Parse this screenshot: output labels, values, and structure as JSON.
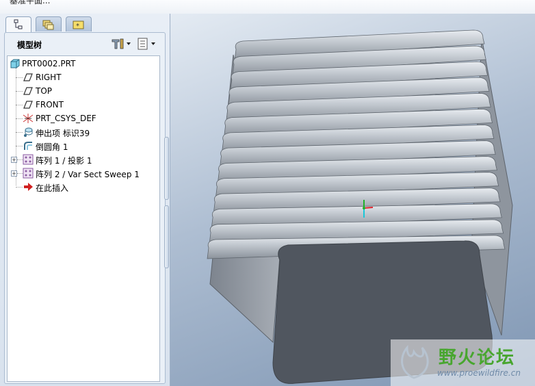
{
  "message_bar": {
    "text": "基准平面..."
  },
  "navigator": {
    "tabs": [
      {
        "name": "model-tree-tab",
        "icon": "model-tree-icon"
      },
      {
        "name": "folder-browser-tab",
        "icon": "folder-icon"
      },
      {
        "name": "favorites-tab",
        "icon": "favorites-icon"
      }
    ],
    "tree_title": "模型树",
    "tools": [
      {
        "name": "settings-button",
        "icon": "hammer-wrench-icon"
      },
      {
        "name": "show-button",
        "icon": "list-icon"
      }
    ],
    "items": [
      {
        "label": "PRT0002.PRT",
        "icon": "part-icon",
        "expandable": false
      },
      {
        "label": "RIGHT",
        "icon": "datum-plane-icon",
        "expandable": false
      },
      {
        "label": "TOP",
        "icon": "datum-plane-icon",
        "expandable": false
      },
      {
        "label": "FRONT",
        "icon": "datum-plane-icon",
        "expandable": false
      },
      {
        "label": "PRT_CSYS_DEF",
        "icon": "csys-icon",
        "expandable": false
      },
      {
        "label": "伸出项 标识39",
        "icon": "protrusion-icon",
        "expandable": false
      },
      {
        "label": "倒圆角 1",
        "icon": "round-icon",
        "expandable": false
      },
      {
        "label": "阵列 1 / 投影 1",
        "icon": "pattern-icon",
        "expandable": true
      },
      {
        "label": "阵列 2 / Var Sect Sweep 1",
        "icon": "pattern-icon",
        "expandable": true
      },
      {
        "label": "在此插入",
        "icon": "insert-here-arrow-icon",
        "expandable": false
      }
    ]
  },
  "watermark": {
    "title": "野火论坛",
    "url": "www.proewildfire.cn"
  },
  "colors": {
    "model_face": "#4f5560",
    "model_side": "#9aa1ab",
    "fin": "#c4cad1",
    "watermark_green": "#48a62f"
  }
}
